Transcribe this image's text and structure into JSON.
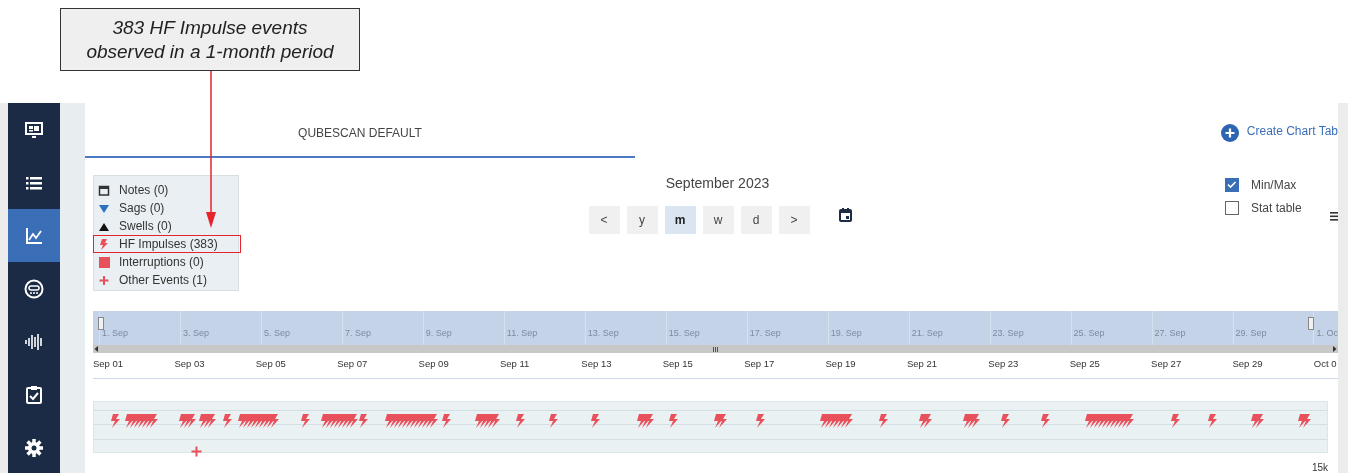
{
  "annotation": {
    "lines": [
      "383 HF Impulse events",
      "observed in a 1-month period"
    ]
  },
  "sidebar": {
    "items": [
      {
        "kind": "dashboard",
        "selected": false
      },
      {
        "kind": "list",
        "selected": false
      },
      {
        "kind": "chart",
        "selected": true
      },
      {
        "kind": "meter",
        "selected": false
      },
      {
        "kind": "waveform",
        "selected": false
      },
      {
        "kind": "clipboard",
        "selected": false
      },
      {
        "kind": "settings",
        "selected": false
      }
    ]
  },
  "tabs": [
    {
      "label": "QUBESCAN DEFAULT",
      "selected": true
    }
  ],
  "create_tab_button": {
    "label": "Create Chart Tab"
  },
  "legend": [
    {
      "kind": "note",
      "label": "Notes (0)",
      "highlighted": false
    },
    {
      "kind": "sag",
      "label": "Sags (0)",
      "highlighted": false
    },
    {
      "kind": "swell",
      "label": "Swells (0)",
      "highlighted": false
    },
    {
      "kind": "impulse",
      "label": "HF Impulses (383)",
      "highlighted": true
    },
    {
      "kind": "interruption",
      "label": "Interruptions (0)",
      "highlighted": false
    },
    {
      "kind": "other",
      "label": "Other Events (1)",
      "highlighted": false
    }
  ],
  "period": {
    "title": "September 2023",
    "buttons": [
      {
        "label": "<",
        "selected": false
      },
      {
        "label": "y",
        "selected": false
      },
      {
        "label": "m",
        "selected": true
      },
      {
        "label": "w",
        "selected": false
      },
      {
        "label": "d",
        "selected": false
      },
      {
        "label": ">",
        "selected": false
      }
    ]
  },
  "options": [
    {
      "label": "Min/Max",
      "checked": true
    },
    {
      "label": "Stat table",
      "checked": false
    }
  ],
  "navigator": {
    "labels": [
      "1. Sep",
      "3. Sep",
      "5. Sep",
      "7. Sep",
      "9. Sep",
      "11. Sep",
      "13. Sep",
      "15. Sep",
      "17. Sep",
      "19. Sep",
      "21. Sep",
      "23. Sep",
      "25. Sep",
      "27. Sep",
      "29. Sep",
      "1. Oc"
    ]
  },
  "axis": {
    "labels": [
      "Sep 01",
      "Sep 03",
      "Sep 05",
      "Sep 07",
      "Sep 09",
      "Sep 11",
      "Sep 13",
      "Sep 15",
      "Sep 17",
      "Sep 19",
      "Sep 21",
      "Sep 23",
      "Sep 25",
      "Sep 27",
      "Sep 29",
      "Oct 0"
    ]
  },
  "event_strip": {
    "axis_value": "15k"
  }
}
